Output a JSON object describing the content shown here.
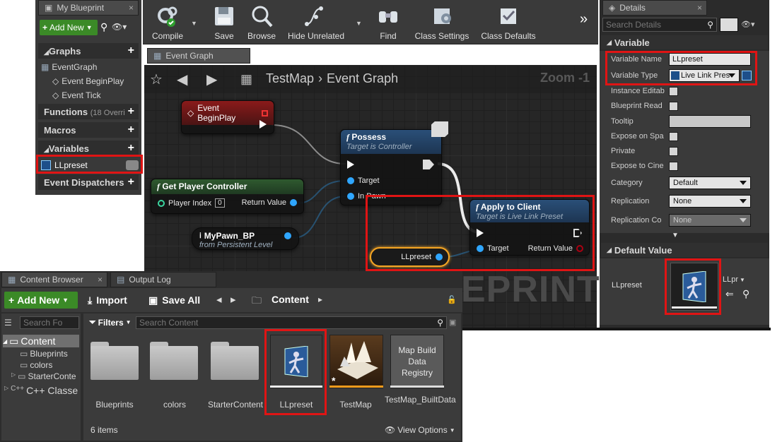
{
  "my_blueprint": {
    "tab_title": "My Blueprint",
    "add_new": "Add New",
    "sections": {
      "graphs": "Graphs",
      "functions": "Functions",
      "functions_count": "(18 Overri",
      "macros": "Macros",
      "variables": "Variables",
      "event_dispatchers": "Event Dispatchers"
    },
    "graph_items": [
      "EventGraph",
      "Event BeginPlay",
      "Event Tick"
    ],
    "variable_item": "LLpreset"
  },
  "toolbar": {
    "buttons": [
      "Compile",
      "Save",
      "Browse",
      "Hide Unrelated",
      "Find",
      "Class Settings",
      "Class Defaults"
    ],
    "more": "»"
  },
  "event_graph": {
    "tab": "Event Graph",
    "breadcrumb_map": "TestMap",
    "breadcrumb_graph": "Event Graph",
    "zoom": "Zoom -1",
    "watermark": "EPRINT",
    "nodes": {
      "begin_play": "Event BeginPlay",
      "possess_title": "Possess",
      "possess_sub": "Target is Controller",
      "possess_target": "Target",
      "possess_inpawn": "In Pawn",
      "gpc_title": "Get Player Controller",
      "gpc_player_index": "Player Index",
      "gpc_index_value": "0",
      "gpc_return": "Return Value",
      "mypawn_title": "MyPawn_BP",
      "mypawn_sub": "from Persistent Level",
      "apply_title": "Apply to Client",
      "apply_sub": "Target is Live Link Preset",
      "apply_target": "Target",
      "apply_return": "Return Value",
      "llpreset_var": "LLpreset"
    }
  },
  "details": {
    "tab_title": "Details",
    "search_placeholder": "Search Details",
    "variable_section": "Variable",
    "rows": {
      "variable_name": "Variable Name",
      "variable_name_value": "LLpreset",
      "variable_type": "Variable Type",
      "variable_type_value": "Live Link Pres",
      "instance_editable": "Instance Editab",
      "blueprint_readonly": "Blueprint Read",
      "tooltip": "Tooltip",
      "expose_spawn": "Expose on Spa",
      "private": "Private",
      "expose_cinematics": "Expose to Cine",
      "category": "Category",
      "category_value": "Default",
      "replication": "Replication",
      "replication_value": "None",
      "replication_condition": "Replication Co",
      "replication_condition_value": "None"
    },
    "default_value_section": "Default Value",
    "default_label": "LLpreset",
    "default_asset_short": "LLpr"
  },
  "content_browser": {
    "tab_title": "Content Browser",
    "output_log_tab": "Output Log",
    "add_new": "Add New",
    "import": "Import",
    "save_all": "Save All",
    "path_root": "Content",
    "folder_search_placeholder": "Search Fo",
    "filters": "Filters",
    "search_placeholder": "Search Content",
    "tree": [
      "Content",
      "Blueprints",
      "colors",
      "StarterConte",
      "C++ Classe"
    ],
    "assets": [
      "Blueprints",
      "colors",
      "StarterContent",
      "LLpreset",
      "TestMap",
      "TestMap_BuiltData"
    ],
    "map_build_registry": "Map Build Data Registry",
    "item_count": "6 items",
    "view_options": "View Options"
  },
  "colors": {
    "highlight_red": "#e01414",
    "exec_wire": "#e8e8e8",
    "object_pin": "#2fa6ff",
    "green_button": "#3b8a27",
    "event_header": "#8a1a1a",
    "function_header": "#2a4f78",
    "pure_header": "#2f5a2f"
  }
}
